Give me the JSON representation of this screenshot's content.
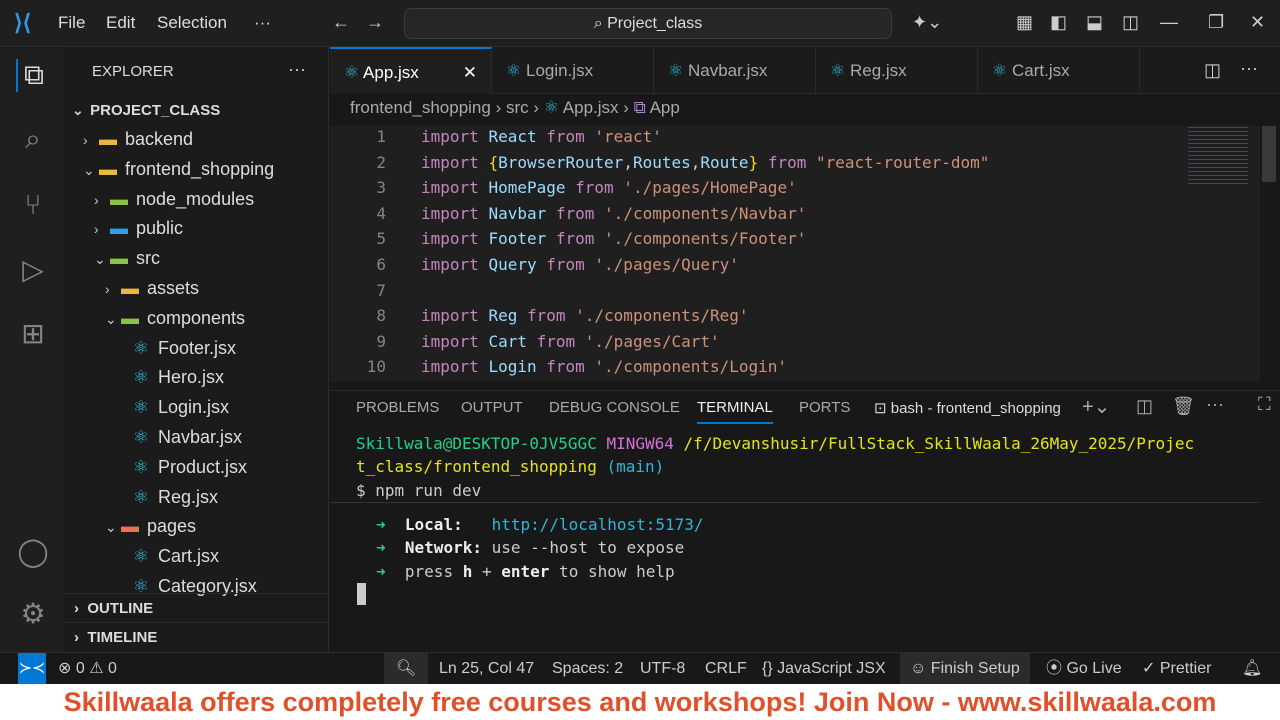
{
  "titlebar": {
    "menus": [
      "File",
      "Edit",
      "Selection",
      "···"
    ],
    "search": "Project_class"
  },
  "explorer": {
    "title": "EXPLORER",
    "more": "···",
    "root": "PROJECT_CLASS",
    "items": [
      {
        "label": "backend",
        "depth": 1,
        "type": "folder",
        "open": false
      },
      {
        "label": "frontend_shopping",
        "depth": 1,
        "type": "folder",
        "open": true
      },
      {
        "label": "node_modules",
        "depth": 2,
        "type": "folder",
        "open": false
      },
      {
        "label": "public",
        "depth": 2,
        "type": "folder",
        "open": false
      },
      {
        "label": "src",
        "depth": 2,
        "type": "folder",
        "open": true
      },
      {
        "label": "assets",
        "depth": 3,
        "type": "folder",
        "open": false
      },
      {
        "label": "components",
        "depth": 3,
        "type": "folder",
        "open": true
      },
      {
        "label": "Footer.jsx",
        "depth": 4,
        "type": "react"
      },
      {
        "label": "Hero.jsx",
        "depth": 4,
        "type": "react"
      },
      {
        "label": "Login.jsx",
        "depth": 4,
        "type": "react"
      },
      {
        "label": "Navbar.jsx",
        "depth": 4,
        "type": "react"
      },
      {
        "label": "Product.jsx",
        "depth": 4,
        "type": "react"
      },
      {
        "label": "Reg.jsx",
        "depth": 4,
        "type": "react"
      },
      {
        "label": "pages",
        "depth": 3,
        "type": "folder",
        "open": true
      },
      {
        "label": "Cart.jsx",
        "depth": 4,
        "type": "react"
      },
      {
        "label": "Category.jsx",
        "depth": 4,
        "type": "react"
      }
    ],
    "outline": "OUTLINE",
    "timeline": "TIMELINE"
  },
  "tabs": [
    {
      "label": "App.jsx",
      "active": true
    },
    {
      "label": "Login.jsx"
    },
    {
      "label": "Navbar.jsx"
    },
    {
      "label": "Reg.jsx"
    },
    {
      "label": "Cart.jsx"
    }
  ],
  "breadcrumb": [
    "frontend_shopping",
    "src",
    "App.jsx",
    "App"
  ],
  "code": [
    [
      [
        "kw",
        "import "
      ],
      [
        "id",
        "React "
      ],
      [
        "kw",
        "from "
      ],
      [
        "str",
        "'react'"
      ]
    ],
    [
      [
        "kw",
        "import "
      ],
      [
        "br",
        "{"
      ],
      [
        "id",
        "BrowserRouter"
      ],
      [
        "pl",
        ","
      ],
      [
        "id",
        "Routes"
      ],
      [
        "pl",
        ","
      ],
      [
        "id",
        "Route"
      ],
      [
        "br",
        "}"
      ],
      [
        "kw",
        " from "
      ],
      [
        "str",
        "\"react-router-dom\""
      ]
    ],
    [
      [
        "kw",
        "import "
      ],
      [
        "id",
        "HomePage "
      ],
      [
        "kw",
        "from "
      ],
      [
        "str",
        "'./pages/HomePage'"
      ]
    ],
    [
      [
        "kw",
        "import "
      ],
      [
        "id",
        "Navbar "
      ],
      [
        "kw",
        "from "
      ],
      [
        "str",
        "'./components/Navbar'"
      ]
    ],
    [
      [
        "kw",
        "import "
      ],
      [
        "id",
        "Footer "
      ],
      [
        "kw",
        "from "
      ],
      [
        "str",
        "'./components/Footer'"
      ]
    ],
    [
      [
        "kw",
        "import "
      ],
      [
        "id",
        "Query "
      ],
      [
        "kw",
        "from "
      ],
      [
        "str",
        "'./pages/Query'"
      ]
    ],
    [],
    [
      [
        "kw",
        "import "
      ],
      [
        "id",
        "Reg "
      ],
      [
        "kw",
        "from "
      ],
      [
        "str",
        "'./components/Reg'"
      ]
    ],
    [
      [
        "kw",
        "import "
      ],
      [
        "id",
        "Cart "
      ],
      [
        "kw",
        "from "
      ],
      [
        "str",
        "'./pages/Cart'"
      ]
    ],
    [
      [
        "kw",
        "import "
      ],
      [
        "id",
        "Login "
      ],
      [
        "kw",
        "from "
      ],
      [
        "str",
        "'./components/Login'"
      ]
    ]
  ],
  "panel": {
    "tabs": [
      "PROBLEMS",
      "OUTPUT",
      "DEBUG CONSOLE",
      "TERMINAL",
      "PORTS"
    ],
    "shell": "bash - frontend_shopping"
  },
  "terminal": {
    "user": "Skillwala@DESKTOP-0JV5GGC",
    "env": "MINGW64",
    "path1": "/f/Devanshusir/FullStack_SkillWaala_26May_2025/Projec",
    "path2": "t_class/frontend_shopping",
    "branch": "(main)",
    "cmd": "$ npm run dev",
    "local_label": "Local:",
    "local_url": "http://localhost:5173/",
    "network_label": "Network:",
    "network_text": "use --host to expose",
    "help_a": "press ",
    "help_h": "h",
    "help_b": " + ",
    "help_enter": "enter",
    "help_c": " to show help",
    "arrow": "➜"
  },
  "status": {
    "errors": "0",
    "warnings": "0",
    "position": "Ln 25, Col 47",
    "spaces": "Spaces: 2",
    "encoding": "UTF-8",
    "eol": "CRLF",
    "language": "JavaScript JSX",
    "finish": "Finish Setup",
    "golive": "Go Live",
    "prettier": "Prettier"
  },
  "banner": "Skillwaala offers completely free courses and workshops! Join Now - www.skillwaala.com"
}
